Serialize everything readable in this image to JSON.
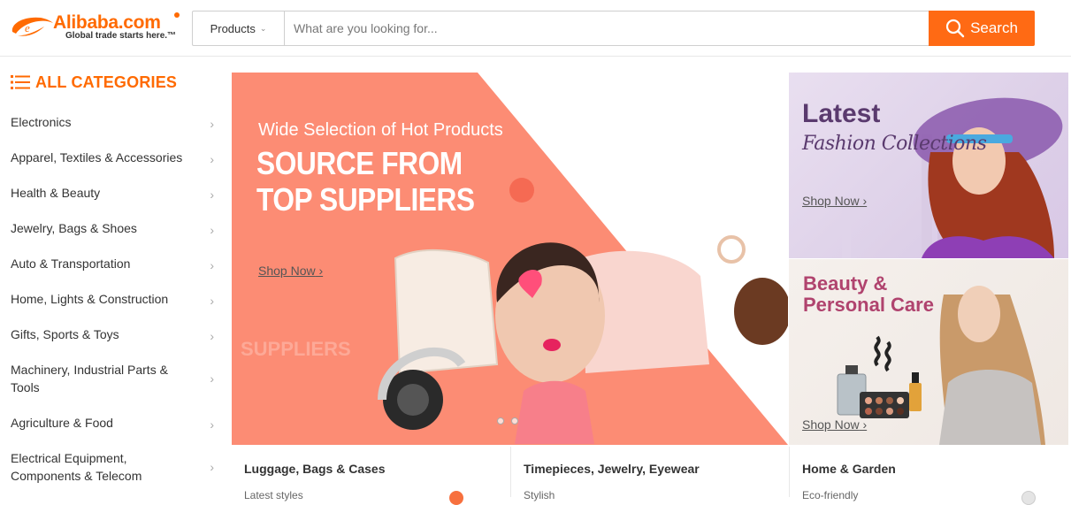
{
  "header": {
    "logo_text": "Alibaba.com",
    "logo_tagline": "Global trade starts here.™",
    "search_category": "Products",
    "search_placeholder": "What are you looking for...",
    "search_button": "Search"
  },
  "sidebar": {
    "title": "ALL CATEGORIES",
    "items": [
      {
        "label": "Electronics"
      },
      {
        "label": "Apparel, Textiles & Accessories"
      },
      {
        "label": "Health & Beauty"
      },
      {
        "label": "Jewelry, Bags & Shoes"
      },
      {
        "label": "Auto & Transportation"
      },
      {
        "label": "Home, Lights & Construction"
      },
      {
        "label": "Gifts, Sports & Toys"
      },
      {
        "label": "Machinery, Industrial Parts & Tools"
      },
      {
        "label": "Agriculture & Food"
      },
      {
        "label": "Electrical Equipment, Components & Telecom"
      }
    ]
  },
  "main_banner": {
    "subtitle": "Wide Selection of Hot Products",
    "title": "SOURCE FROM TOP SUPPLIERS",
    "cta": "Shop Now",
    "watermark": "SUPPLIERS"
  },
  "side_banners": {
    "fashion": {
      "title": "Latest",
      "subtitle": "Fashion Collections",
      "cta": "Shop Now"
    },
    "beauty": {
      "title": "Beauty & Personal Care",
      "cta": "Shop Now"
    }
  },
  "bottom_categories": [
    {
      "title": "Luggage, Bags & Cases",
      "subtitle": "Latest styles"
    },
    {
      "title": "Timepieces, Jewelry, Eyewear",
      "subtitle": "Stylish"
    },
    {
      "title": "Home & Garden",
      "subtitle": "Eco-friendly"
    }
  ],
  "colors": {
    "brand_orange": "#ff6a00",
    "search_button": "#ff6a14",
    "banner_salmon": "#fc8c74",
    "fashion_purple": "#5a3a6e",
    "beauty_pink": "#b0436e"
  },
  "icons": {
    "logo": "alibaba-logo-icon",
    "search": "search-icon",
    "categories": "list-icon",
    "chevron": "chevron-right-icon"
  }
}
